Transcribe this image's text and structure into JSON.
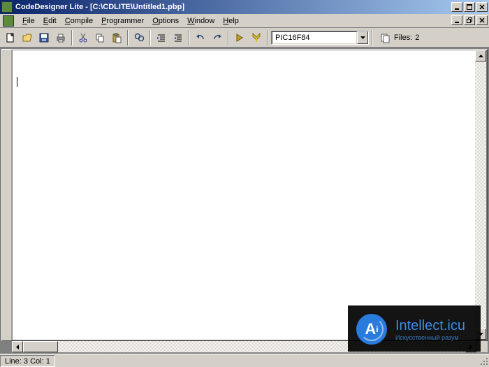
{
  "title": "CodeDesigner Lite - [C:\\CDLITE\\Untitled1.pbp]",
  "menu": {
    "file": "File",
    "edit": "Edit",
    "compile": "Compile",
    "programmer": "Programmer",
    "options": "Options",
    "window": "Window",
    "help": "Help"
  },
  "toolbar": {
    "device": "PIC16F84",
    "files_label": "Files:",
    "files_count": "2"
  },
  "status": {
    "line_col": "Line: 3 Col: 1"
  },
  "watermark": {
    "letter": "A",
    "name": "Intellect.icu",
    "subtitle": "Искусственный разум"
  }
}
